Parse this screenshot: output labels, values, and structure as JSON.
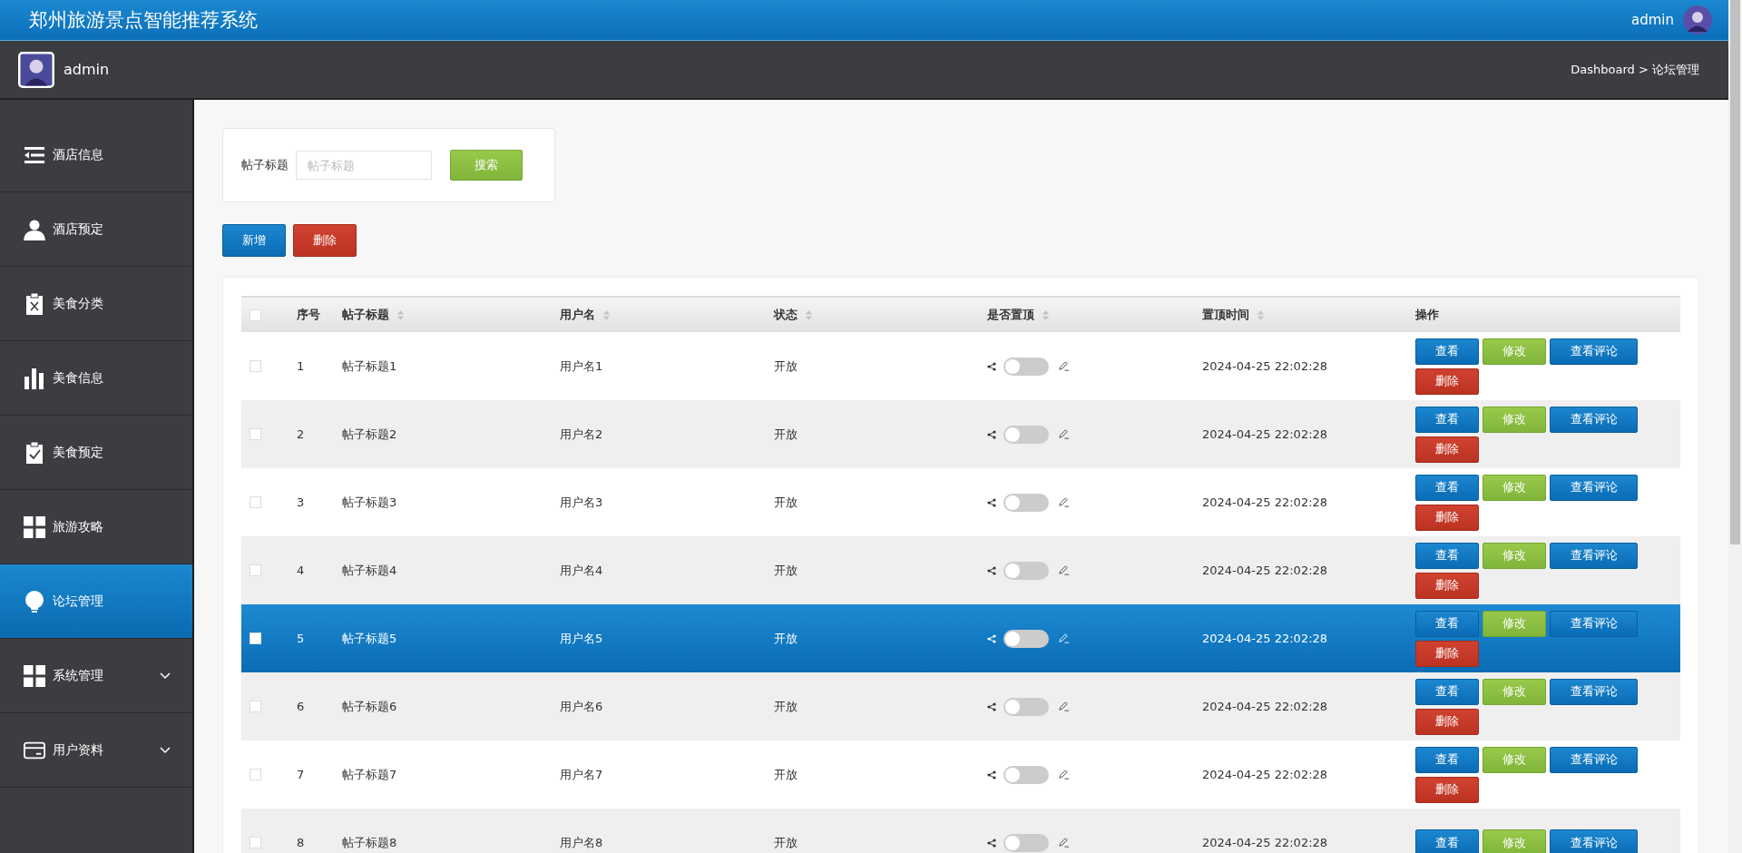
{
  "header": {
    "title": "郑州旅游景点智能推荐系统",
    "user": "admin"
  },
  "subbar": {
    "user": "admin",
    "breadcrumb": "Dashboard > 论坛管理"
  },
  "sidebar": {
    "items": [
      {
        "label": "酒店信息",
        "kind": "list",
        "expandable": false,
        "selected": false
      },
      {
        "label": "酒店预定",
        "kind": "person",
        "expandable": false,
        "selected": false
      },
      {
        "label": "美食分类",
        "kind": "reject",
        "expandable": false,
        "selected": false
      },
      {
        "label": "美食信息",
        "kind": "stats",
        "expandable": false,
        "selected": false
      },
      {
        "label": "美食预定",
        "kind": "task",
        "expandable": false,
        "selected": false
      },
      {
        "label": "旅游攻略",
        "kind": "grid",
        "expandable": false,
        "selected": false
      },
      {
        "label": "论坛管理",
        "kind": "idea",
        "expandable": false,
        "selected": true
      },
      {
        "label": "系统管理",
        "kind": "grid",
        "expandable": true,
        "selected": false
      },
      {
        "label": "用户资料",
        "kind": "card",
        "expandable": true,
        "selected": false
      }
    ]
  },
  "search": {
    "label": "帖子标题",
    "placeholder": "帖子标题",
    "button": "搜索"
  },
  "actions": [
    {
      "label": "新增",
      "kind": "primary"
    },
    {
      "label": "删除",
      "kind": "danger"
    }
  ],
  "table": {
    "header_checked": false,
    "columns": [
      {
        "label": "序号",
        "sortable": false
      },
      {
        "label": "帖子标题",
        "sortable": true
      },
      {
        "label": "用户名",
        "sortable": true
      },
      {
        "label": "状态",
        "sortable": true
      },
      {
        "label": "是否置顶",
        "sortable": true
      },
      {
        "label": "置顶时间",
        "sortable": true
      },
      {
        "label": "操作",
        "sortable": false
      }
    ],
    "rows": [
      {
        "no": "1",
        "title": "帖子标题1",
        "user": "用户名1",
        "status": "开放",
        "on": false,
        "time": "2024-04-25 22:02:28",
        "checked": false,
        "selected": false,
        "buttons": [
          {
            "label": "查看",
            "kind": "primary"
          },
          {
            "label": "修改",
            "kind": "success"
          },
          {
            "label": "查看评论",
            "kind": "primary"
          },
          {
            "label": "删除",
            "kind": "danger"
          }
        ]
      },
      {
        "no": "2",
        "title": "帖子标题2",
        "user": "用户名2",
        "status": "开放",
        "on": false,
        "time": "2024-04-25 22:02:28",
        "checked": false,
        "selected": false,
        "buttons": [
          {
            "label": "查看",
            "kind": "primary"
          },
          {
            "label": "修改",
            "kind": "success"
          },
          {
            "label": "查看评论",
            "kind": "primary"
          },
          {
            "label": "删除",
            "kind": "danger"
          }
        ]
      },
      {
        "no": "3",
        "title": "帖子标题3",
        "user": "用户名3",
        "status": "开放",
        "on": false,
        "time": "2024-04-25 22:02:28",
        "checked": false,
        "selected": false,
        "buttons": [
          {
            "label": "查看",
            "kind": "primary"
          },
          {
            "label": "修改",
            "kind": "success"
          },
          {
            "label": "查看评论",
            "kind": "primary"
          },
          {
            "label": "删除",
            "kind": "danger"
          }
        ]
      },
      {
        "no": "4",
        "title": "帖子标题4",
        "user": "用户名4",
        "status": "开放",
        "on": false,
        "time": "2024-04-25 22:02:28",
        "checked": false,
        "selected": false,
        "buttons": [
          {
            "label": "查看",
            "kind": "primary"
          },
          {
            "label": "修改",
            "kind": "success"
          },
          {
            "label": "查看评论",
            "kind": "primary"
          },
          {
            "label": "删除",
            "kind": "danger"
          }
        ]
      },
      {
        "no": "5",
        "title": "帖子标题5",
        "user": "用户名5",
        "status": "开放",
        "on": false,
        "time": "2024-04-25 22:02:28",
        "checked": false,
        "selected": true,
        "buttons": [
          {
            "label": "查看",
            "kind": "primary"
          },
          {
            "label": "修改",
            "kind": "success"
          },
          {
            "label": "查看评论",
            "kind": "primary"
          },
          {
            "label": "删除",
            "kind": "danger"
          }
        ]
      },
      {
        "no": "6",
        "title": "帖子标题6",
        "user": "用户名6",
        "status": "开放",
        "on": false,
        "time": "2024-04-25 22:02:28",
        "checked": false,
        "selected": false,
        "buttons": [
          {
            "label": "查看",
            "kind": "primary"
          },
          {
            "label": "修改",
            "kind": "success"
          },
          {
            "label": "查看评论",
            "kind": "primary"
          },
          {
            "label": "删除",
            "kind": "danger"
          }
        ]
      },
      {
        "no": "7",
        "title": "帖子标题7",
        "user": "用户名7",
        "status": "开放",
        "on": false,
        "time": "2024-04-25 22:02:28",
        "checked": false,
        "selected": false,
        "buttons": [
          {
            "label": "查看",
            "kind": "primary"
          },
          {
            "label": "修改",
            "kind": "success"
          },
          {
            "label": "查看评论",
            "kind": "primary"
          },
          {
            "label": "删除",
            "kind": "danger"
          }
        ]
      },
      {
        "no": "8",
        "title": "帖子标题8",
        "user": "用户名8",
        "status": "开放",
        "on": false,
        "time": "2024-04-25 22:02:28",
        "checked": false,
        "selected": false,
        "buttons": [
          {
            "label": "查看",
            "kind": "primary"
          },
          {
            "label": "修改",
            "kind": "success"
          },
          {
            "label": "查看评论",
            "kind": "primary"
          }
        ]
      }
    ]
  }
}
